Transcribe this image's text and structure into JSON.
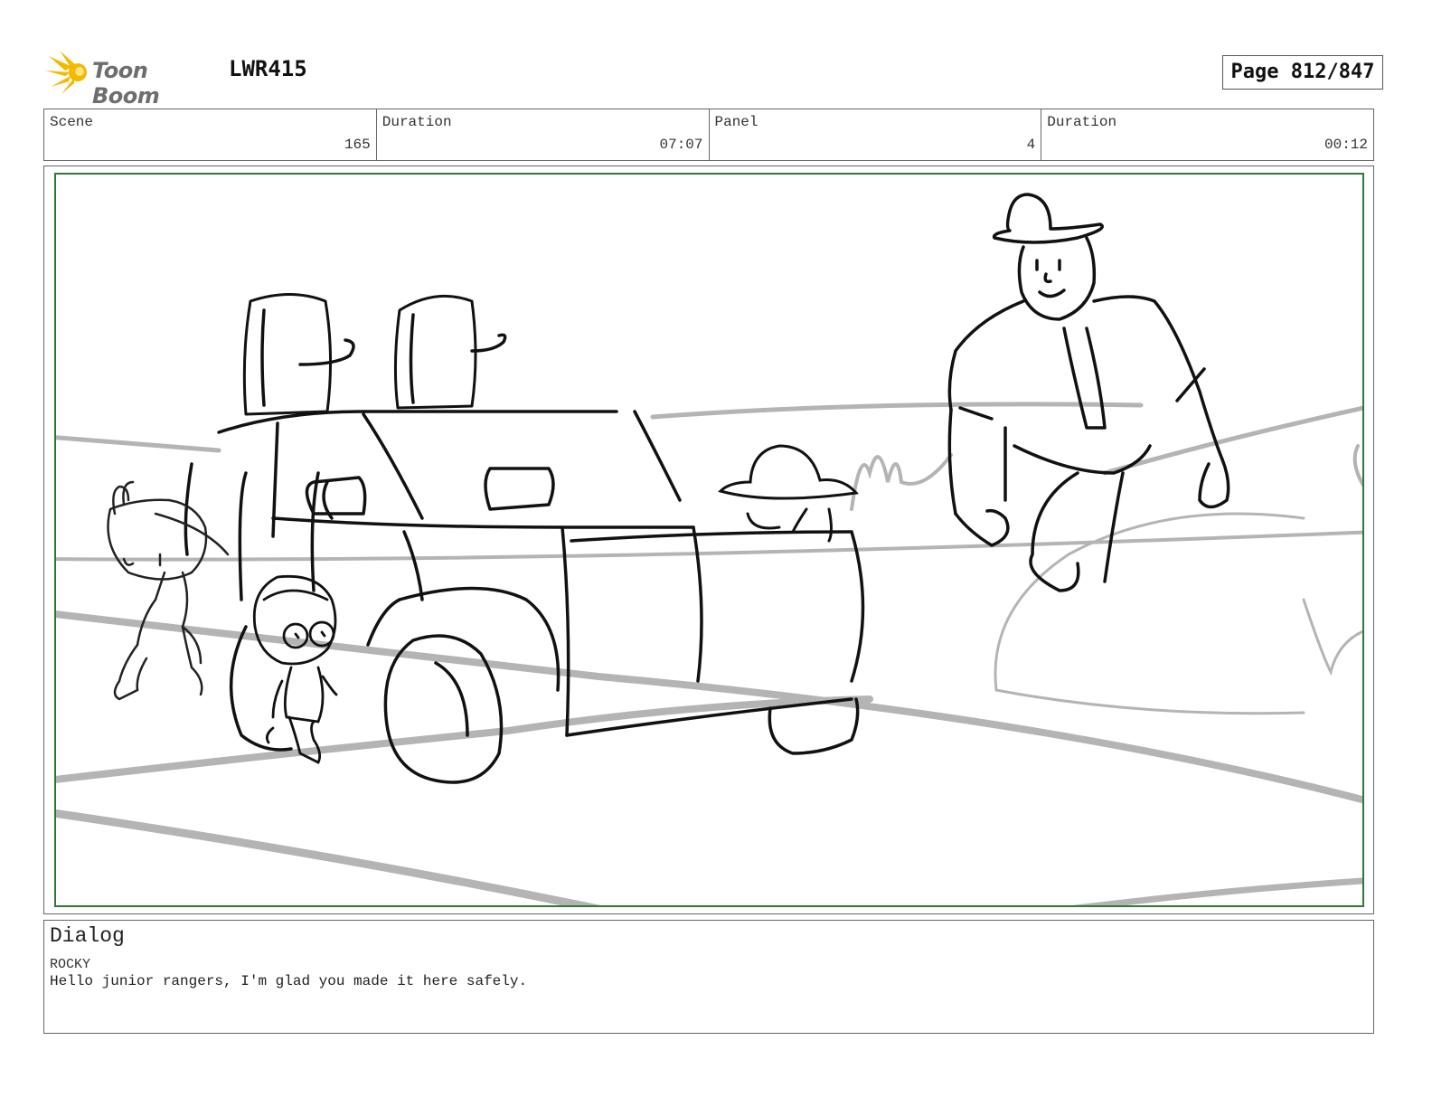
{
  "header": {
    "logo_text": "Toon Boom",
    "project_code": "LWR415",
    "page_label": "Page 812/847"
  },
  "info": {
    "scene_label": "Scene",
    "scene_value": "165",
    "scene_duration_label": "Duration",
    "scene_duration_value": "07:07",
    "panel_label": "Panel",
    "panel_value": "4",
    "panel_duration_label": "Duration",
    "panel_duration_value": "00:12"
  },
  "dialog": {
    "title": "Dialog",
    "character": "ROCKY",
    "line": "Hello junior rangers, I'm glad you made it here safely."
  },
  "colors": {
    "safe_frame": "#2d7a36",
    "logo_accent": "#f5b800",
    "sketch_line": "#111111",
    "sketch_background": "#b4b4b4"
  }
}
